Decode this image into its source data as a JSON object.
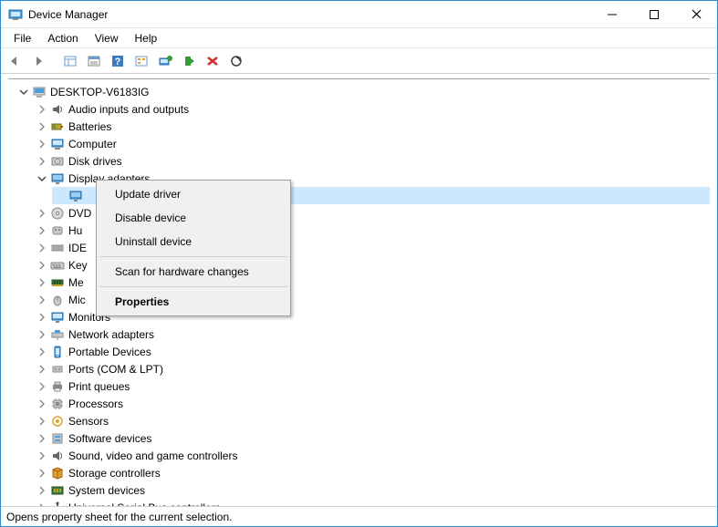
{
  "window": {
    "title": "Device Manager"
  },
  "menubar": {
    "items": [
      "File",
      "Action",
      "View",
      "Help"
    ]
  },
  "toolbar": {
    "buttons": [
      "back-icon",
      "forward-icon",
      "sep",
      "show-hidden-icon",
      "properties-icon",
      "help-icon",
      "devices-icon",
      "update-driver-icon",
      "enable-icon",
      "disable-icon",
      "uninstall-icon"
    ]
  },
  "tree": {
    "root": {
      "label": "DESKTOP-V6183IG",
      "expanded": true
    },
    "categories": [
      {
        "label": "Audio inputs and outputs",
        "expanded": false,
        "icon": "audio"
      },
      {
        "label": "Batteries",
        "expanded": false,
        "icon": "battery"
      },
      {
        "label": "Computer",
        "expanded": false,
        "icon": "computer"
      },
      {
        "label": "Disk drives",
        "expanded": false,
        "icon": "disk"
      },
      {
        "label": "Display adapters",
        "expanded": true,
        "icon": "display",
        "children": [
          {
            "label": "",
            "selected": true
          }
        ]
      },
      {
        "label": "DVD",
        "expanded": false,
        "icon": "dvd",
        "truncated": true
      },
      {
        "label": "Hu",
        "expanded": false,
        "icon": "hid",
        "truncated": true
      },
      {
        "label": "IDE",
        "expanded": false,
        "icon": "ide",
        "truncated": true
      },
      {
        "label": "Key",
        "expanded": false,
        "icon": "keyboard",
        "truncated": true
      },
      {
        "label": "Me",
        "expanded": false,
        "icon": "memory",
        "truncated": true
      },
      {
        "label": "Mic",
        "expanded": false,
        "icon": "mouse",
        "truncated": true
      },
      {
        "label": "Monitors",
        "expanded": false,
        "icon": "monitor"
      },
      {
        "label": "Network adapters",
        "expanded": false,
        "icon": "network"
      },
      {
        "label": "Portable Devices",
        "expanded": false,
        "icon": "portable"
      },
      {
        "label": "Ports (COM & LPT)",
        "expanded": false,
        "icon": "port"
      },
      {
        "label": "Print queues",
        "expanded": false,
        "icon": "printer"
      },
      {
        "label": "Processors",
        "expanded": false,
        "icon": "cpu"
      },
      {
        "label": "Sensors",
        "expanded": false,
        "icon": "sensor"
      },
      {
        "label": "Software devices",
        "expanded": false,
        "icon": "software"
      },
      {
        "label": "Sound, video and game controllers",
        "expanded": false,
        "icon": "sound"
      },
      {
        "label": "Storage controllers",
        "expanded": false,
        "icon": "storage"
      },
      {
        "label": "System devices",
        "expanded": false,
        "icon": "system"
      },
      {
        "label": "Universal Serial Bus controllers",
        "expanded": false,
        "icon": "usb"
      }
    ]
  },
  "context_menu": {
    "items": [
      {
        "label": "Update driver"
      },
      {
        "label": "Disable device"
      },
      {
        "label": "Uninstall device"
      },
      {
        "sep": true
      },
      {
        "label": "Scan for hardware changes"
      },
      {
        "sep": true
      },
      {
        "label": "Properties",
        "bold": true
      }
    ]
  },
  "statusbar": {
    "text": "Opens property sheet for the current selection."
  }
}
